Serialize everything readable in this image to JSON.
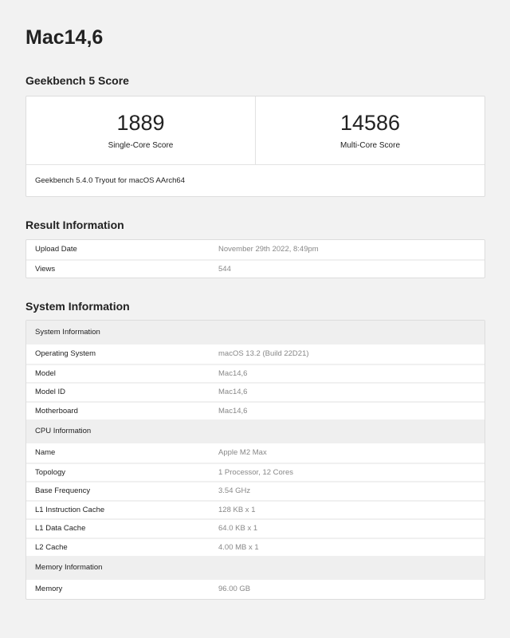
{
  "title": "Mac14,6",
  "score_section": {
    "heading": "Geekbench 5 Score",
    "single": {
      "value": "1889",
      "label": "Single-Core Score"
    },
    "multi": {
      "value": "14586",
      "label": "Multi-Core Score"
    },
    "version": "Geekbench 5.4.0 Tryout for macOS AArch64"
  },
  "result_info": {
    "heading": "Result Information",
    "rows": [
      {
        "k": "Upload Date",
        "v": "November 29th 2022, 8:49pm"
      },
      {
        "k": "Views",
        "v": "544"
      }
    ]
  },
  "system_info": {
    "heading": "System Information",
    "groups": [
      {
        "title": "System Information",
        "rows": [
          {
            "k": "Operating System",
            "v": "macOS 13.2 (Build 22D21)"
          },
          {
            "k": "Model",
            "v": "Mac14,6"
          },
          {
            "k": "Model ID",
            "v": "Mac14,6"
          },
          {
            "k": "Motherboard",
            "v": "Mac14,6"
          }
        ]
      },
      {
        "title": "CPU Information",
        "rows": [
          {
            "k": "Name",
            "v": "Apple M2 Max"
          },
          {
            "k": "Topology",
            "v": "1 Processor, 12 Cores"
          },
          {
            "k": "Base Frequency",
            "v": "3.54 GHz"
          },
          {
            "k": "L1 Instruction Cache",
            "v": "128 KB x 1"
          },
          {
            "k": "L1 Data Cache",
            "v": "64.0 KB x 1"
          },
          {
            "k": "L2 Cache",
            "v": "4.00 MB x 1"
          }
        ]
      },
      {
        "title": "Memory Information",
        "rows": [
          {
            "k": "Memory",
            "v": "96.00 GB"
          }
        ]
      }
    ]
  }
}
